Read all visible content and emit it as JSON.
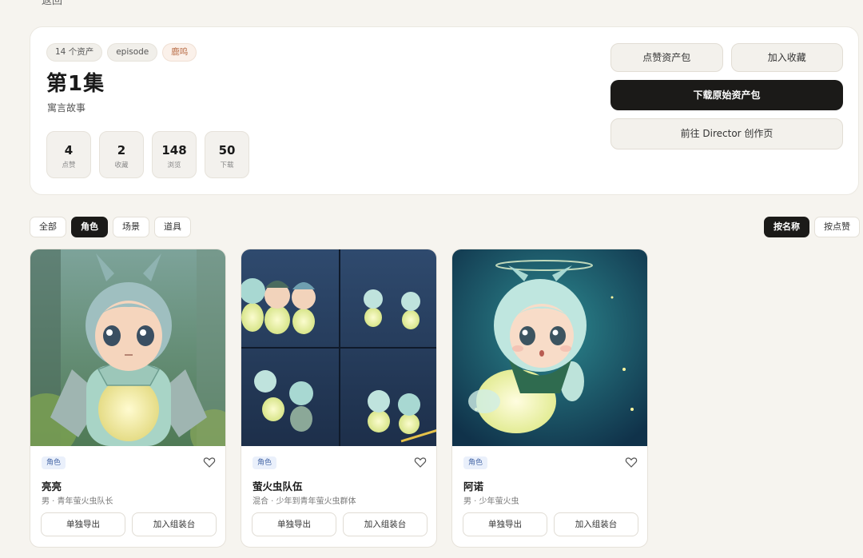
{
  "topcut": "返回",
  "hero": {
    "pills": [
      "14 个资产",
      "episode",
      "鹿鸣"
    ],
    "title": "第1集",
    "subtitle": "寓言故事",
    "stats": [
      {
        "value": "4",
        "label": "点赞"
      },
      {
        "value": "2",
        "label": "收藏"
      },
      {
        "value": "148",
        "label": "浏览"
      },
      {
        "value": "50",
        "label": "下载"
      }
    ],
    "actions": {
      "like": "点赞资产包",
      "favorite": "加入收藏",
      "download": "下载原始资产包",
      "director": "前往 Director 创作页"
    }
  },
  "filters": [
    "全部",
    "角色",
    "场景",
    "道具"
  ],
  "active_filter": "角色",
  "sorts": [
    "按名称",
    "按点赞"
  ],
  "active_sort": "按名称",
  "cards": [
    {
      "tag": "角色",
      "name": "亮亮",
      "desc": "男 · 青年萤火虫队长",
      "export": "单独导出",
      "assemble": "加入组装台"
    },
    {
      "tag": "角色",
      "name": "萤火虫队伍",
      "desc": "混合 · 少年到青年萤火虫群体",
      "export": "单独导出",
      "assemble": "加入组装台"
    },
    {
      "tag": "角色",
      "name": "阿诺",
      "desc": "男 · 少年萤火虫",
      "export": "单独导出",
      "assemble": "加入组装台"
    }
  ],
  "colors": {
    "accent_dark": "#1b1a18",
    "tag_bg": "#eaf0fb",
    "tag_text": "#4a6aa8",
    "page_bg": "#f6f4ef"
  }
}
